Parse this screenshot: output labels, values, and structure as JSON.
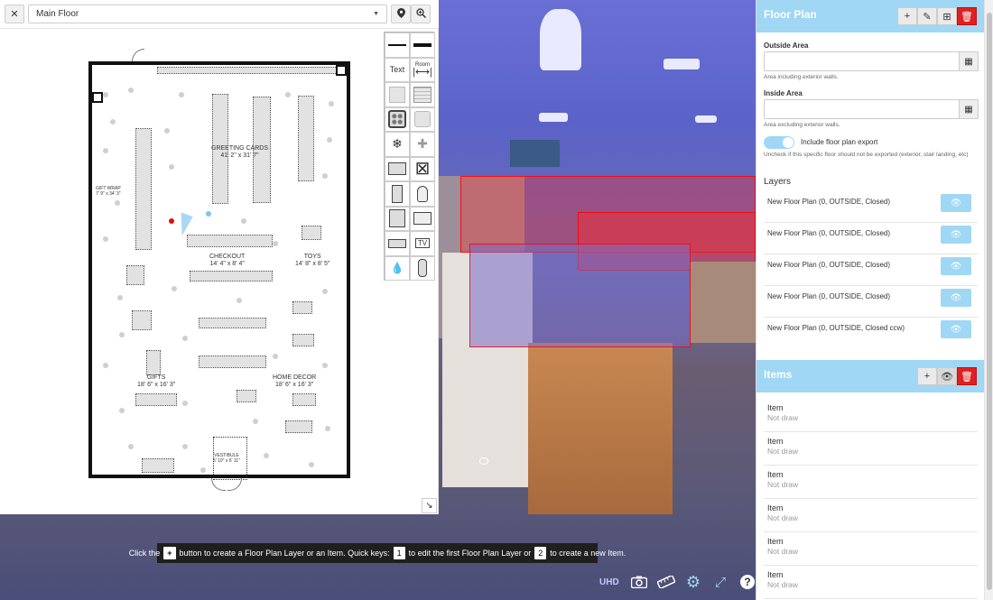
{
  "floor_plan": {
    "close_label": "✕",
    "floor_select": "Main Floor",
    "plan_labels": {
      "greeting_cards": "GREETING CARDS",
      "greeting_cards_dim": "41' 2\" x 31' 7\"",
      "checkout": "CHECKOUT",
      "checkout_dim": "14' 4\" x 8' 4\"",
      "toys": "TOYS",
      "toys_dim": "14' 8\" x 8' 5\"",
      "gifts": "GIFTS",
      "gifts_dim": "18' 6\" x 16' 3\"",
      "home_decor": "HOME DECOR",
      "home_decor_dim": "18' 6\" x 16' 3\"",
      "gift_wrap": "GIFT WRAP",
      "gift_wrap_dim": "7' 9\" x 34' 3\"",
      "vestibule": "VESTIBULE",
      "vestibule_dim": "5' 10\" x 6' 11\""
    },
    "tools": {
      "text_label": "Text",
      "room_label": "Room",
      "tv_label": "TV"
    }
  },
  "hint": {
    "part1": "Click the",
    "plus": "+",
    "part2": "button to create a Floor Plan Layer or an Item. Quick keys:",
    "key1": "1",
    "part3": "to edit the first Floor Plan Layer or",
    "key2": "2",
    "part4": "to create a new Item."
  },
  "bottom_tools": {
    "uhd": "UHD"
  },
  "sidebar": {
    "floor_plan_title": "Floor Plan",
    "outside_area_label": "Outside Area",
    "outside_area_help": "Area including exterior walls.",
    "inside_area_label": "Inside Area",
    "inside_area_help": "Area excluding exterior walls.",
    "include_export_label": "Include floor plan export",
    "include_export_help": "Uncheck if this specific floor should not be exported (exterior, stair landing, etc)",
    "layers_title": "Layers",
    "layers": [
      {
        "name": "New Floor Plan (0, OUTSIDE, Closed)"
      },
      {
        "name": "New Floor Plan (0, OUTSIDE, Closed)"
      },
      {
        "name": "New Floor Plan (0, OUTSIDE, Closed)"
      },
      {
        "name": "New Floor Plan (0, OUTSIDE, Closed)"
      },
      {
        "name": "New Floor Plan (0, OUTSIDE, Closed ccw)"
      }
    ],
    "items_title": "Items",
    "items": [
      {
        "name": "Item",
        "status": "Not draw"
      },
      {
        "name": "Item",
        "status": "Not draw"
      },
      {
        "name": "Item",
        "status": "Not draw"
      },
      {
        "name": "Item",
        "status": "Not draw"
      },
      {
        "name": "Item",
        "status": "Not draw"
      },
      {
        "name": "Item",
        "status": "Not draw"
      }
    ]
  },
  "colors": {
    "accent": "#9fd7f5",
    "danger": "#e02020",
    "overlay_red": "#ff2828"
  }
}
